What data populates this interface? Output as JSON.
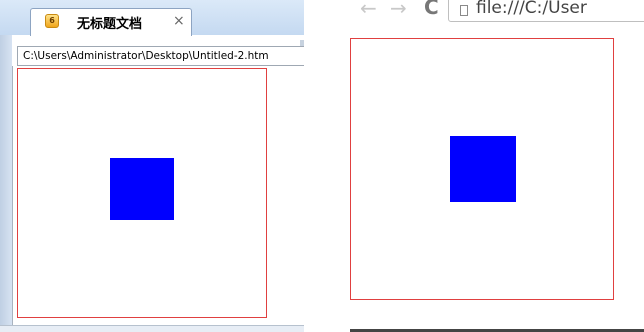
{
  "left_browser": {
    "tab_icon_glyph": "6",
    "tab_title": "无标题文档",
    "tab_close": "×",
    "address": "C:\\Users\\Administrator\\Desktop\\Untitled-2.htm"
  },
  "right_browser": {
    "back_glyph": "←",
    "forward_glyph": "→",
    "reload_glyph": "C",
    "url": "file:///C:/User"
  },
  "colors": {
    "box_border": "#e04040",
    "square_fill": "#0000ff"
  }
}
